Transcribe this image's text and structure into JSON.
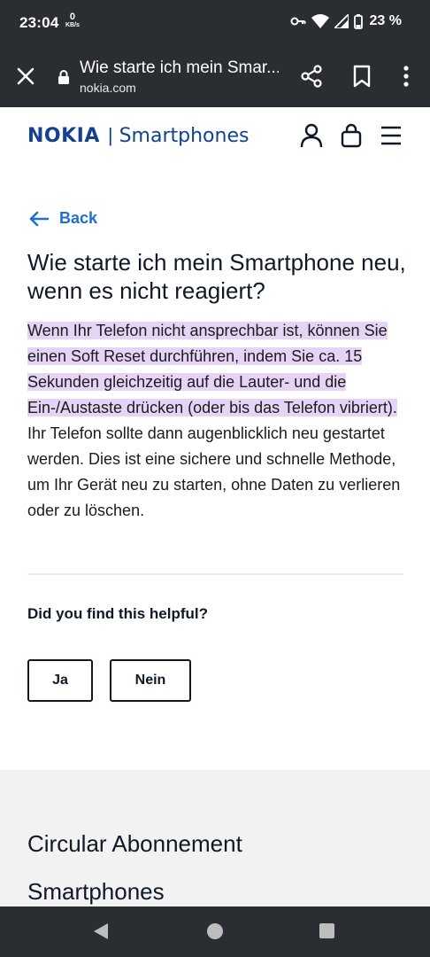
{
  "status_bar": {
    "time": "23:04",
    "net_speed_value": "0",
    "net_speed_unit": "KB/s",
    "battery": "23 %"
  },
  "browser": {
    "page_title": "Wie starte ich mein Smar...",
    "host": "nokia.com"
  },
  "header": {
    "brand": "NOKIA",
    "separator": "|",
    "section": "Smartphones"
  },
  "back_label": "Back",
  "article": {
    "title": "Wie starte ich mein Smartphone neu, wenn es nicht reagiert?",
    "highlighted_text": "Wenn Ihr Telefon nicht ansprechbar ist, können Sie einen Soft Reset durchführen, indem Sie ca. 15 Sekunden gleichzeitig auf die Lauter- und die Ein-/Austaste drücken (oder bis das Telefon vibriert).",
    "rest_text": " Ihr Telefon sollte dann augenblicklich neu gestartet werden. Dies ist eine sichere und schnelle Methode, um Ihr Gerät neu zu starten, ohne Daten zu verlieren oder zu löschen.",
    "highlight_color": "#e6d4f6"
  },
  "feedback": {
    "question": "Did you find this helpful?",
    "yes_label": "Ja",
    "no_label": "Nein"
  },
  "footer": {
    "links": [
      "Circular Abonnement",
      "Smartphones"
    ]
  },
  "colors": {
    "brand_blue": "#124191",
    "link_blue": "#1f6fd1",
    "chrome_dark": "#2a2d31"
  }
}
